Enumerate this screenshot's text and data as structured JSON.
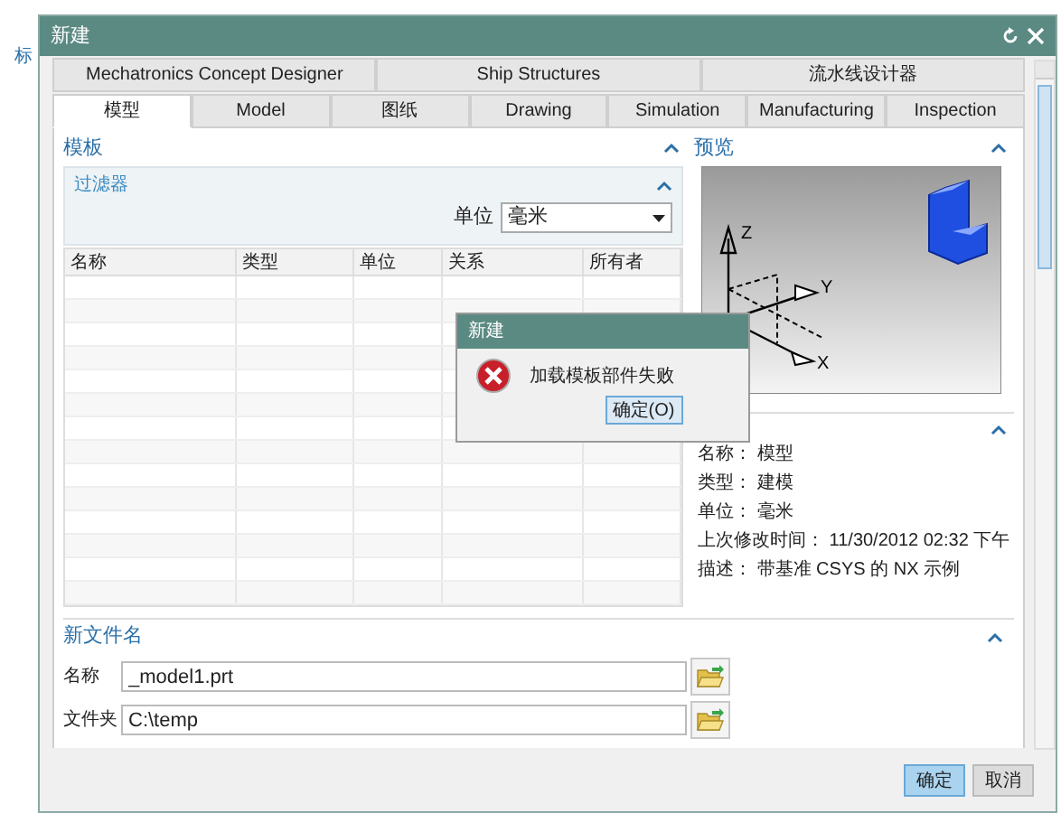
{
  "background_app": {
    "toolbar_label": "标"
  },
  "window": {
    "title": "新建"
  },
  "tab_rows": [
    [
      {
        "label": "Mechatronics Concept Designer",
        "selected": false
      },
      {
        "label": "Ship Structures",
        "selected": false
      },
      {
        "label": "流水线设计器",
        "selected": false
      }
    ],
    [
      {
        "label": "模型",
        "selected": true
      },
      {
        "label": "Model",
        "selected": false
      },
      {
        "label": "图纸",
        "selected": false
      },
      {
        "label": "Drawing",
        "selected": false
      },
      {
        "label": "Simulation",
        "selected": false
      },
      {
        "label": "Manufacturing",
        "selected": false
      },
      {
        "label": "Inspection",
        "selected": false
      }
    ]
  ],
  "templates": {
    "title": "模板",
    "expanded": true,
    "filter": {
      "title": "过滤器",
      "expanded": true,
      "unit_label": "单位",
      "unit_value": "毫米"
    },
    "columns": [
      "名称",
      "类型",
      "单位",
      "关系",
      "所有者"
    ]
  },
  "preview": {
    "title": "预览",
    "expanded": true,
    "axis_labels": [
      "Z",
      "Y",
      "X"
    ]
  },
  "properties": {
    "expanded": true,
    "lines": [
      "名称： 模型",
      "类型： 建模",
      "单位： 毫米",
      "上次修改时间： 11/30/2012 02:32 下午",
      "描述： 带基准 CSYS 的 NX 示例"
    ]
  },
  "new_file": {
    "title": "新文件名",
    "expanded": true,
    "fields": [
      {
        "label": "名称",
        "value": "_model1.prt"
      },
      {
        "label": "文件夹",
        "value": "C:\\temp"
      }
    ]
  },
  "buttons": [
    {
      "label": "确定",
      "primary": true
    },
    {
      "label": "取消",
      "primary": false
    }
  ],
  "message_box": {
    "title": "新建",
    "message": "加载模板部件失败",
    "button": "确定(O)"
  }
}
